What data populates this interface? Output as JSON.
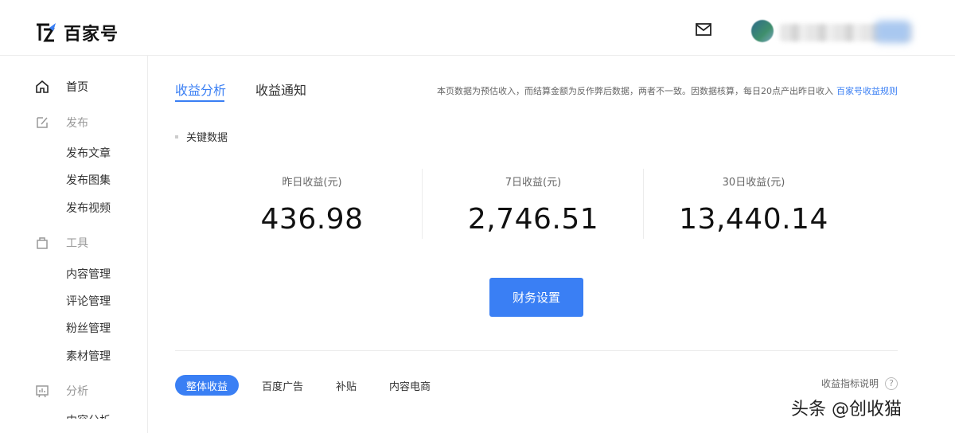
{
  "header": {
    "logo_text": "百家号",
    "mail_icon": "mail-icon"
  },
  "sidebar": {
    "items": [
      {
        "label": "首页",
        "icon": "home-icon",
        "active": true
      },
      {
        "label": "发布",
        "icon": "edit-icon"
      },
      {
        "label": "发布文章"
      },
      {
        "label": "发布图集"
      },
      {
        "label": "发布视频"
      },
      {
        "label": "工具",
        "icon": "toolbox-icon"
      },
      {
        "label": "内容管理"
      },
      {
        "label": "评论管理"
      },
      {
        "label": "粉丝管理"
      },
      {
        "label": "素材管理"
      },
      {
        "label": "分析",
        "icon": "chart-icon"
      }
    ]
  },
  "tabs": [
    {
      "label": "收益分析",
      "active": true
    },
    {
      "label": "收益通知"
    }
  ],
  "notice": {
    "text": "本页数据为预估收入，而结算金额为反作弊后数据，两者不一致。因数据核算，每日20点产出昨日收入",
    "link": "百家号收益规则"
  },
  "section_label": "关键数据",
  "stats": [
    {
      "label": "昨日收益(元)",
      "value": "436.98"
    },
    {
      "label": "7日收益(元)",
      "value": "2,746.51"
    },
    {
      "label": "30日收益(元)",
      "value": "13,440.14"
    }
  ],
  "finance_button": "财务设置",
  "filters": [
    {
      "label": "整体收益",
      "active": true
    },
    {
      "label": "百度广告"
    },
    {
      "label": "补贴"
    },
    {
      "label": "内容电商"
    }
  ],
  "help_text": "收益指标说明",
  "help_icon": "?",
  "watermark": "头条 @创收猫",
  "colors": {
    "accent": "#3a7ff4"
  }
}
